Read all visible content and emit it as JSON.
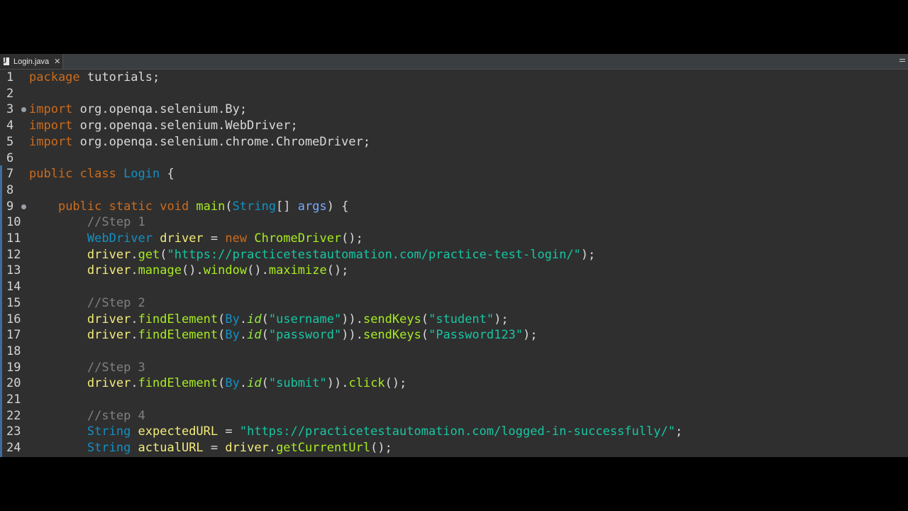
{
  "tab": {
    "label": "Login.java"
  },
  "lines": [
    {
      "n": "1",
      "tokens": [
        [
          "kw",
          "package"
        ],
        [
          "pkg",
          " tutorials;"
        ]
      ]
    },
    {
      "n": "2",
      "tokens": []
    },
    {
      "n": "3",
      "fold": true,
      "tokens": [
        [
          "kw",
          "import"
        ],
        [
          "pkg",
          " org.openqa.selenium.By;"
        ]
      ]
    },
    {
      "n": "4",
      "tokens": [
        [
          "kw",
          "import"
        ],
        [
          "pkg",
          " org.openqa.selenium.WebDriver;"
        ]
      ]
    },
    {
      "n": "5",
      "tokens": [
        [
          "kw",
          "import"
        ],
        [
          "pkg",
          " org.openqa.selenium.chrome.ChromeDriver;"
        ]
      ]
    },
    {
      "n": "6",
      "tokens": []
    },
    {
      "n": "7",
      "tokens": [
        [
          "kw",
          "public class "
        ],
        [
          "cname",
          "Login"
        ],
        [
          "pkg",
          " {"
        ]
      ]
    },
    {
      "n": "8",
      "tokens": []
    },
    {
      "n": "9",
      "fold": true,
      "tokens": [
        [
          "pkg",
          "    "
        ],
        [
          "kw",
          "public static void "
        ],
        [
          "mth",
          "main"
        ],
        [
          "pkg",
          "("
        ],
        [
          "ty",
          "String"
        ],
        [
          "pkg",
          "[] "
        ],
        [
          "param",
          "args"
        ],
        [
          "pkg",
          ") {"
        ]
      ]
    },
    {
      "n": "10",
      "tokens": [
        [
          "pkg",
          "        "
        ],
        [
          "cmt",
          "//Step 1"
        ]
      ]
    },
    {
      "n": "11",
      "tokens": [
        [
          "pkg",
          "        "
        ],
        [
          "ty",
          "WebDriver "
        ],
        [
          "lvar",
          "driver"
        ],
        [
          "pkg",
          " = "
        ],
        [
          "kw",
          "new "
        ],
        [
          "ctor",
          "ChromeDriver"
        ],
        [
          "pkg",
          "();"
        ]
      ]
    },
    {
      "n": "12",
      "tokens": [
        [
          "pkg",
          "        "
        ],
        [
          "lvar",
          "driver"
        ],
        [
          "pkg",
          "."
        ],
        [
          "mth",
          "get"
        ],
        [
          "pkg",
          "("
        ],
        [
          "str",
          "\"https://practicetestautomation.com/practice-test-login/\""
        ],
        [
          "pkg",
          ");"
        ]
      ]
    },
    {
      "n": "13",
      "tokens": [
        [
          "pkg",
          "        "
        ],
        [
          "lvar",
          "driver"
        ],
        [
          "pkg",
          "."
        ],
        [
          "mth",
          "manage"
        ],
        [
          "pkg",
          "()."
        ],
        [
          "mth",
          "window"
        ],
        [
          "pkg",
          "()."
        ],
        [
          "mth",
          "maximize"
        ],
        [
          "pkg",
          "();"
        ]
      ]
    },
    {
      "n": "14",
      "tokens": []
    },
    {
      "n": "15",
      "tokens": [
        [
          "pkg",
          "        "
        ],
        [
          "cmt",
          "//Step 2"
        ]
      ]
    },
    {
      "n": "16",
      "tokens": [
        [
          "pkg",
          "        "
        ],
        [
          "lvar",
          "driver"
        ],
        [
          "pkg",
          "."
        ],
        [
          "mth",
          "findElement"
        ],
        [
          "pkg",
          "("
        ],
        [
          "ty",
          "By"
        ],
        [
          "pkg",
          "."
        ],
        [
          "stat",
          "id"
        ],
        [
          "pkg",
          "("
        ],
        [
          "str",
          "\"username\""
        ],
        [
          "pkg",
          "))."
        ],
        [
          "mth",
          "sendKeys"
        ],
        [
          "pkg",
          "("
        ],
        [
          "str",
          "\"student\""
        ],
        [
          "pkg",
          ");"
        ]
      ]
    },
    {
      "n": "17",
      "tokens": [
        [
          "pkg",
          "        "
        ],
        [
          "lvar",
          "driver"
        ],
        [
          "pkg",
          "."
        ],
        [
          "mth",
          "findElement"
        ],
        [
          "pkg",
          "("
        ],
        [
          "ty",
          "By"
        ],
        [
          "pkg",
          "."
        ],
        [
          "stat",
          "id"
        ],
        [
          "pkg",
          "("
        ],
        [
          "str",
          "\"password\""
        ],
        [
          "pkg",
          "))."
        ],
        [
          "mth",
          "sendKeys"
        ],
        [
          "pkg",
          "("
        ],
        [
          "str",
          "\"Password123\""
        ],
        [
          "pkg",
          ");"
        ]
      ]
    },
    {
      "n": "18",
      "tokens": []
    },
    {
      "n": "19",
      "tokens": [
        [
          "pkg",
          "        "
        ],
        [
          "cmt",
          "//Step 3"
        ]
      ]
    },
    {
      "n": "20",
      "tokens": [
        [
          "pkg",
          "        "
        ],
        [
          "lvar",
          "driver"
        ],
        [
          "pkg",
          "."
        ],
        [
          "mth",
          "findElement"
        ],
        [
          "pkg",
          "("
        ],
        [
          "ty",
          "By"
        ],
        [
          "pkg",
          "."
        ],
        [
          "stat",
          "id"
        ],
        [
          "pkg",
          "("
        ],
        [
          "str",
          "\"submit\""
        ],
        [
          "pkg",
          "))."
        ],
        [
          "mth",
          "click"
        ],
        [
          "pkg",
          "();"
        ]
      ]
    },
    {
      "n": "21",
      "tokens": []
    },
    {
      "n": "22",
      "tokens": [
        [
          "pkg",
          "        "
        ],
        [
          "cmt",
          "//step 4"
        ]
      ]
    },
    {
      "n": "23",
      "tokens": [
        [
          "pkg",
          "        "
        ],
        [
          "ty",
          "String "
        ],
        [
          "lvar",
          "expectedURL"
        ],
        [
          "pkg",
          " = "
        ],
        [
          "str",
          "\"https://practicetestautomation.com/logged-in-successfully/\""
        ],
        [
          "pkg",
          ";"
        ]
      ]
    },
    {
      "n": "24",
      "tokens": [
        [
          "pkg",
          "        "
        ],
        [
          "ty",
          "String "
        ],
        [
          "lvar",
          "actualURL"
        ],
        [
          "pkg",
          " = "
        ],
        [
          "lvar",
          "driver"
        ],
        [
          "pkg",
          "."
        ],
        [
          "mth",
          "getCurrentUrl"
        ],
        [
          "pkg",
          "();"
        ]
      ]
    }
  ]
}
